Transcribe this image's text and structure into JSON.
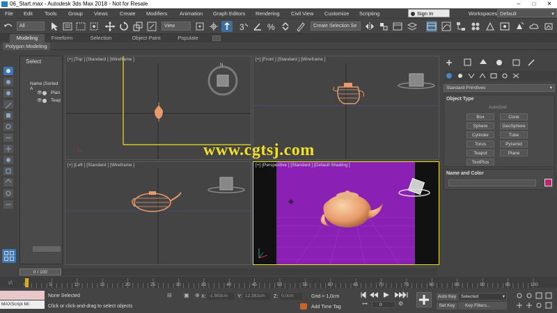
{
  "window": {
    "title": "06_Start.max - Autodesk 3ds Max 2018 - Not for Resale",
    "controls": [
      "–",
      "□",
      "✕"
    ]
  },
  "menu": {
    "items": [
      "File",
      "Edit",
      "Tools",
      "Group",
      "Views",
      "Create",
      "Modifiers",
      "Animation",
      "Graph Editors",
      "Rendering",
      "Civil View",
      "Customize",
      "Scripting"
    ],
    "sign_in": "Sign In",
    "workspaces_label": "Workspaces:",
    "workspace_value": "Default"
  },
  "toolbar": {
    "selection_filter": "All",
    "reference_coord": "View",
    "named_selection": "Create Selection Se"
  },
  "ribbon": {
    "tabs": [
      "Modeling",
      "Freeform",
      "Selection",
      "Object Paint",
      "Populate"
    ],
    "subpanel": "Polygon Modeling"
  },
  "scene_explorer": {
    "title": "Select",
    "column": "Name (Sorted A",
    "items": [
      "Plan",
      "Teap"
    ]
  },
  "viewports": {
    "top": "[+] [Top ] [Standard ] [Wireframe ]",
    "front": "[+] [Front ] [Standard ] [Wireframe ]",
    "left": "[+] [Left ] [Standard ] [Wireframe ]",
    "perspective": "[+] [Perspective ] [Standard ] [Default Shading ]"
  },
  "watermark": "www.cgtsj.com",
  "command_panel": {
    "category": "Standard Primitives",
    "object_type_title": "Object Type",
    "autogrid": "AutoGrid",
    "buttons": [
      "Box",
      "Cone",
      "Sphere",
      "GeoSphere",
      "Cylinder",
      "Tube",
      "Torus",
      "Pyramid",
      "Teapot",
      "Plane",
      "TextPlus"
    ],
    "name_color_title": "Name and Color",
    "object_color": "#c8206e"
  },
  "timeline": {
    "frame_counter": "0 / 100",
    "ticks": [
      "0",
      "5",
      "10",
      "15",
      "20",
      "25",
      "30",
      "35",
      "40",
      "45",
      "50",
      "55",
      "60",
      "65",
      "70",
      "75",
      "80",
      "85",
      "90",
      "95",
      "100"
    ]
  },
  "status": {
    "maxscript": "MAXScript Mi:",
    "selection": "None Selected",
    "prompt": "Click or click-and-drag to select objects",
    "x_label": "X:",
    "x_value": "-1,983cm",
    "y_label": "Y:",
    "y_value": "12,381cm",
    "z_label": "Z:",
    "z_value": "0,0cm",
    "grid": "Grid = 1,0cm",
    "add_time_tag": "Add Time Tag",
    "auto_key": "Auto Key",
    "set_key": "Set Key",
    "selected": "Selected",
    "key_filters": "Key Filters...",
    "frame": "0"
  },
  "colors": {
    "perspective_bg": "#8b20b4",
    "teapot": "#e89a6a",
    "selection_yellow": "#f2e022"
  }
}
